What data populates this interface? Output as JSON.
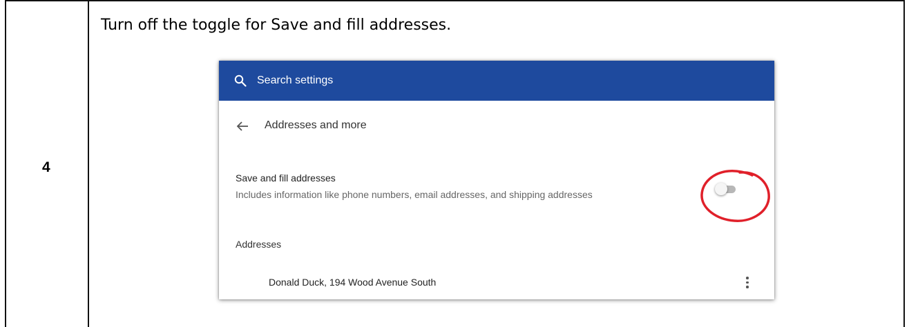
{
  "step": {
    "number": "4",
    "instruction": "Turn off the toggle for Save and fill addresses."
  },
  "search": {
    "placeholder": "Search settings",
    "icon": "search-icon"
  },
  "page": {
    "title": "Addresses and more",
    "back_icon": "arrow-back-icon"
  },
  "setting": {
    "title": "Save and fill addresses",
    "description": "Includes information like phone numbers, email addresses, and shipping addresses",
    "toggle_state": "off"
  },
  "addresses": {
    "header": "Addresses",
    "items": [
      {
        "text": "Donald Duck, 194 Wood Avenue South",
        "menu_icon": "more-vert-icon"
      }
    ]
  },
  "colors": {
    "header_blue": "#1e4a9e",
    "highlight_red": "#e0202a",
    "toggle_track_off": "#b7b7b7"
  }
}
